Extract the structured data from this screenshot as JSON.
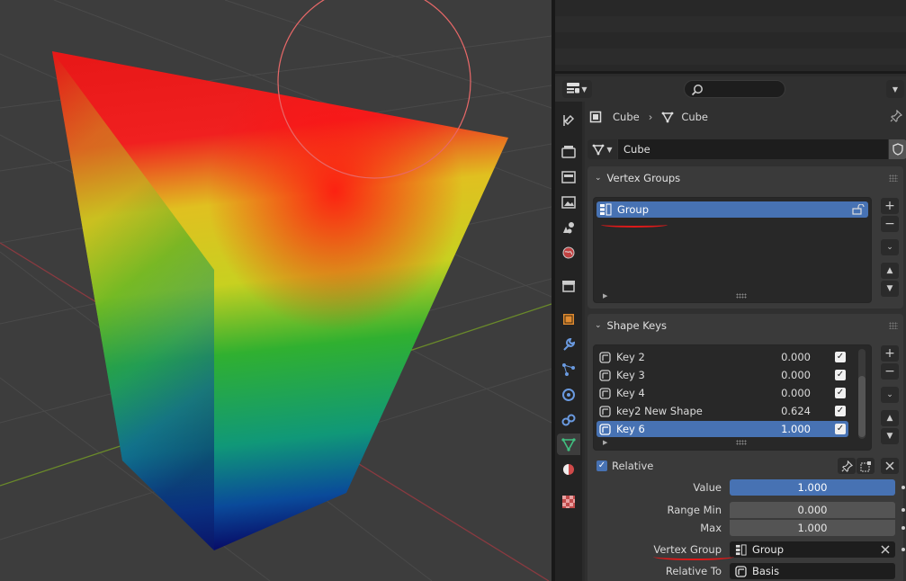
{
  "breadcrumb": {
    "object_name": "Cube",
    "mesh_name": "Cube"
  },
  "datablock": {
    "name": "Cube"
  },
  "vertex_groups": {
    "title": "Vertex Groups",
    "items": [
      {
        "name": "Group",
        "selected": true
      }
    ]
  },
  "shape_keys": {
    "title": "Shape Keys",
    "items": [
      {
        "name": "Key 2",
        "value": "0.000",
        "checked": true
      },
      {
        "name": "Key 3",
        "value": "0.000",
        "checked": true
      },
      {
        "name": "Key 4",
        "value": "0.000",
        "checked": true
      },
      {
        "name": "key2 New Shape",
        "value": "0.624",
        "checked": true
      },
      {
        "name": "Key 6",
        "value": "1.000",
        "checked": true,
        "selected": true
      }
    ],
    "relative_label": "Relative",
    "value_label": "Value",
    "value": "1.000",
    "range_min_label": "Range Min",
    "range_min": "0.000",
    "max_label": "Max",
    "max": "1.000",
    "vertex_group_label": "Vertex Group",
    "vertex_group": "Group",
    "relative_to_label": "Relative To",
    "relative_to": "Basis"
  },
  "colors": {
    "accent": "#4772b3",
    "annotation": "#dd1a1a",
    "gradient": [
      "#ff1010",
      "#d8d020",
      "#20b030",
      "#1090a0",
      "#101080"
    ]
  },
  "icons": [
    "editor-type-icon",
    "search-icon",
    "pin-icon",
    "object-icon",
    "mesh-icon",
    "shield-icon",
    "shape-key-icon",
    "vertex-group-icon",
    "close-icon",
    "lock-icon"
  ]
}
